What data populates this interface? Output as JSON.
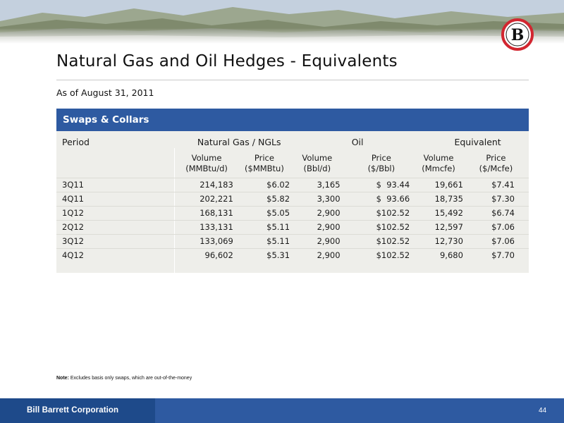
{
  "slide": {
    "title": "Natural Gas and Oil Hedges - Equivalents",
    "as_of": "As of August 31, 2011",
    "page_number": "44"
  },
  "panel": {
    "title": "Swaps & Collars"
  },
  "table": {
    "period_header": "Period",
    "groups": [
      "Natural Gas / NGLs",
      "Oil",
      "Equivalent"
    ],
    "subheaders": [
      [
        "Volume",
        "(MMBtu/d)"
      ],
      [
        "Price",
        "($MMBtu)"
      ],
      [
        "Volume",
        "(Bbl/d)"
      ],
      [
        "Price",
        "($/Bbl)"
      ],
      [
        "Volume",
        "(Mmcfe)"
      ],
      [
        "Price",
        "($/Mcfe)"
      ]
    ],
    "rows": [
      [
        "3Q11",
        "214,183",
        "$6.02",
        "3,165",
        "$  93.44",
        "19,661",
        "$7.41"
      ],
      [
        "4Q11",
        "202,221",
        "$5.82",
        "3,300",
        "$  93.66",
        "18,735",
        "$7.30"
      ],
      [
        "1Q12",
        "168,131",
        "$5.05",
        "2,900",
        "$102.52",
        "15,492",
        "$6.74"
      ],
      [
        "2Q12",
        "133,131",
        "$5.11",
        "2,900",
        "$102.52",
        "12,597",
        "$7.06"
      ],
      [
        "3Q12",
        "133,069",
        "$5.11",
        "2,900",
        "$102.52",
        "12,730",
        "$7.06"
      ],
      [
        "4Q12",
        "96,602",
        "$5.31",
        "2,900",
        "$102.52",
        "9,680",
        "$7.70"
      ]
    ]
  },
  "note": {
    "label": "Note:",
    "text": "Excludes basis only swaps, which are out-of-the-money"
  },
  "footer": {
    "company": "Bill Barrett Corporation"
  },
  "logo": {
    "letter": "B",
    "ring_color": "#d22630"
  },
  "colors": {
    "header_blue": "#2e5aa1",
    "footer_dark_blue": "#1e4a8a",
    "panel_gray": "#eeeeea"
  }
}
